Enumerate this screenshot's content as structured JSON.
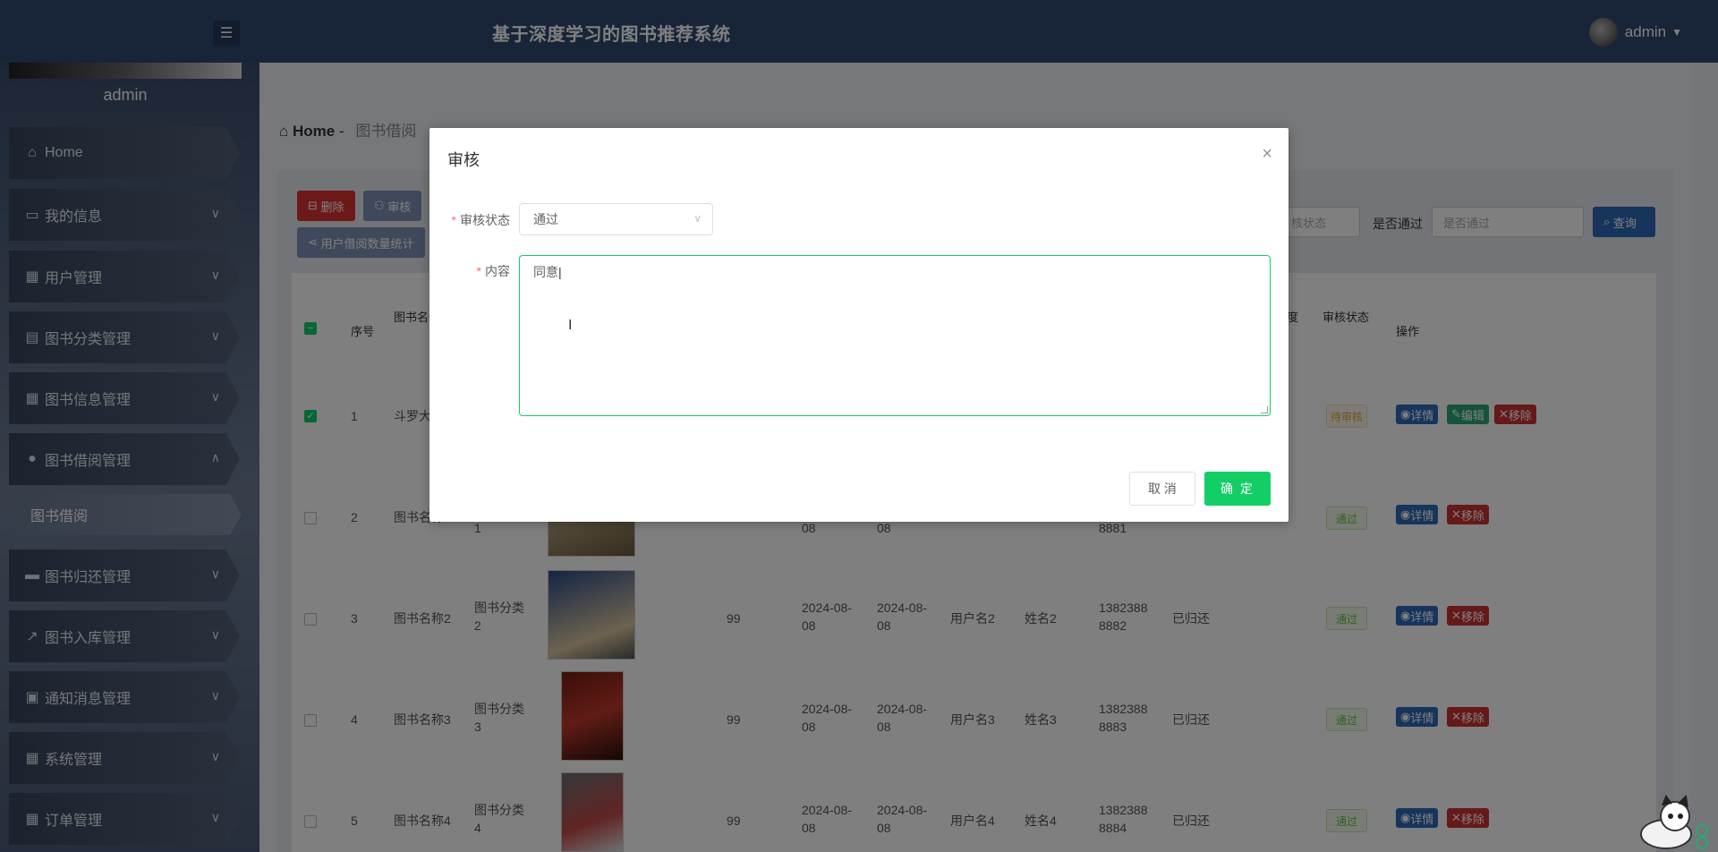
{
  "header": {
    "title": "基于深度学习的图书推荐系统",
    "user": "admin"
  },
  "sidebar": {
    "user": "admin",
    "items": [
      {
        "label": "Home",
        "icon": "home-icon"
      },
      {
        "label": "我的信息",
        "icon": "card-icon"
      },
      {
        "label": "用户管理",
        "icon": "grid-icon"
      },
      {
        "label": "图书分类管理",
        "icon": "briefcase-icon"
      },
      {
        "label": "图书信息管理",
        "icon": "grid-icon"
      },
      {
        "label": "图书借阅管理",
        "icon": "user-icon"
      },
      {
        "label": "图书归还管理",
        "icon": "desktop-icon"
      },
      {
        "label": "图书入库管理",
        "icon": "chart-icon"
      },
      {
        "label": "通知消息管理",
        "icon": "clipboard-icon"
      },
      {
        "label": "系统管理",
        "icon": "grid-icon"
      },
      {
        "label": "订单管理",
        "icon": "grid-icon"
      }
    ],
    "sub_item": "图书借阅"
  },
  "breadcrumb": {
    "home": "Home",
    "sep": "-",
    "current": "图书借阅"
  },
  "toolbar": {
    "delete": "删除",
    "audit": "审核",
    "stats": "用户借阅数量统计",
    "filter_status_placeholder": "核状态",
    "pass_label": "是否通过",
    "pass_placeholder": "是否通过",
    "search": "查询"
  },
  "table": {
    "headers": {
      "no": "序号",
      "name": "图书名",
      "audit_status": "审核状态",
      "ops": "操作",
      "clipped": "度"
    },
    "rows": [
      {
        "no": "1",
        "name": "斗罗大",
        "status": "待审核",
        "checked": true
      },
      {
        "no": "2",
        "name": "图书名称",
        "cat": "1",
        "d1": "08",
        "d2": "08",
        "phone": "8881",
        "status": "通过"
      },
      {
        "no": "3",
        "name": "图书名称2",
        "cat": "图书分类\n2",
        "qty": "99",
        "d1": "2024-08-\n08",
        "d2": "2024-08-\n08",
        "user": "用户名2",
        "real": "姓名2",
        "phone": "1382388\n8882",
        "ret": "已归还",
        "status": "通过"
      },
      {
        "no": "4",
        "name": "图书名称3",
        "cat": "图书分类\n3",
        "qty": "99",
        "d1": "2024-08-\n08",
        "d2": "2024-08-\n08",
        "user": "用户名3",
        "real": "姓名3",
        "phone": "1382388\n8883",
        "ret": "已归还",
        "status": "通过"
      },
      {
        "no": "5",
        "name": "图书名称4",
        "cat": "图书分类\n4",
        "qty": "99",
        "d1": "2024-08-\n08",
        "d2": "2024-08-\n08",
        "user": "用户名4",
        "real": "姓名4",
        "phone": "1382388\n8884",
        "ret": "已归还",
        "status": "通过"
      }
    ],
    "actions": {
      "detail": "详情",
      "edit": "编辑",
      "remove": "移除"
    }
  },
  "dialog": {
    "title": "审核",
    "status_label": "审核状态",
    "status_value": "通过",
    "content_label": "内容",
    "content_value": "同意",
    "cancel": "取 消",
    "confirm": "确 定"
  },
  "colors": {
    "accent": "#13ce66",
    "header": "#31486e",
    "danger": "#cc3333",
    "primary": "#2f6bb8"
  }
}
